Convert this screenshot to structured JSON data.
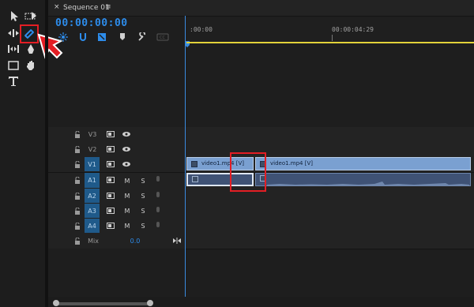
{
  "panel": {
    "close_label": "×",
    "sequence_title": "Sequence 01",
    "menu_label": "≡",
    "timecode": "00:00:00:00"
  },
  "ruler": {
    "labels": [
      ":00:00",
      "00:00:04:29"
    ]
  },
  "tracks": {
    "video": [
      {
        "label": "V3",
        "targeted": false
      },
      {
        "label": "V2",
        "targeted": false
      },
      {
        "label": "V1",
        "targeted": true
      }
    ],
    "audio": [
      {
        "label": "A1",
        "m": "M",
        "s": "S"
      },
      {
        "label": "A2",
        "m": "M",
        "s": "S"
      },
      {
        "label": "A3",
        "m": "M",
        "s": "S"
      },
      {
        "label": "A4",
        "m": "M",
        "s": "S"
      }
    ],
    "mix": {
      "label": "Mix",
      "value": "0.0"
    }
  },
  "clips": {
    "v1_left": "video1.mp4 [V]",
    "v1_right": "video1.mp4 [V]"
  },
  "colors": {
    "accent": "#2d8ceb",
    "highlight": "#e31e24",
    "work_area": "#e2d23a",
    "clip": "#7aa0d1"
  },
  "tools": [
    "selection-tool-icon",
    "track-select-tool-icon",
    "ripple-edit-tool-icon",
    "razor-tool-icon",
    "slip-tool-icon",
    "pen-tool-icon",
    "rectangle-tool-icon",
    "hand-tool-icon",
    "type-tool-icon"
  ]
}
